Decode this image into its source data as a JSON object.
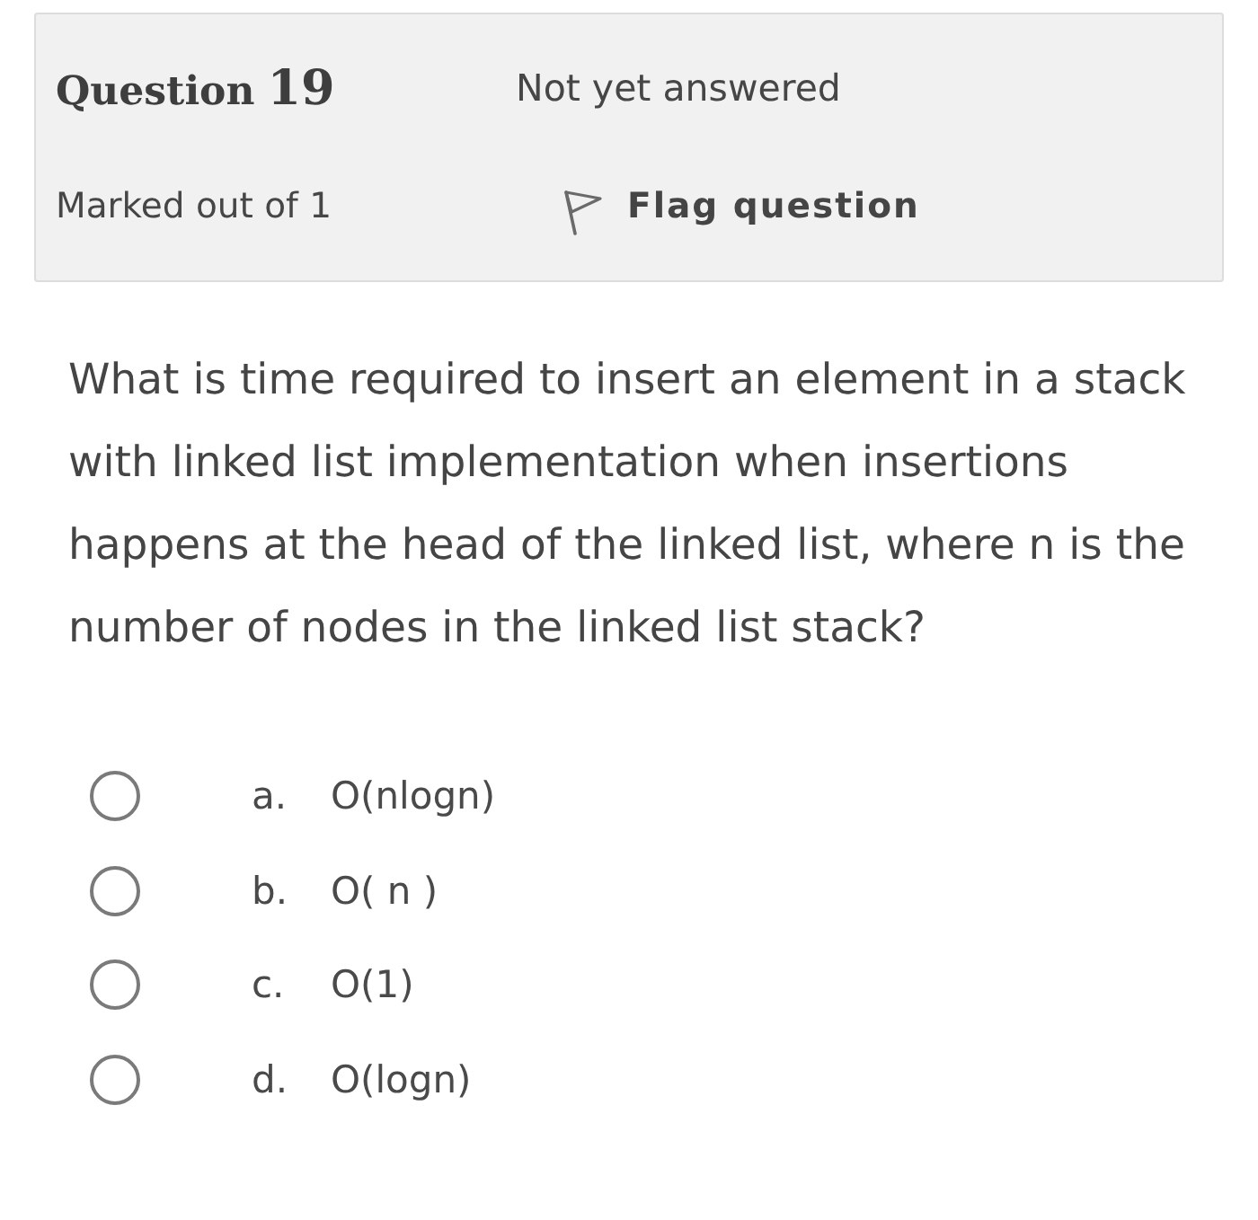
{
  "question_info": {
    "title": "Question",
    "number": "19",
    "status": "Not yet answered",
    "marks": "Marked out of 1",
    "flag": {
      "label": "Flag question",
      "flagged": false
    }
  },
  "question_text": "What is time required to insert an element in a stack with linked list implementation when insertions happens at the head of the linked list, where n is the number of nodes in the linked list stack?",
  "options": [
    {
      "letter": "a.",
      "text": "O(nlogn)",
      "selected": false
    },
    {
      "letter": "b.",
      "text": "O( n )",
      "selected": false
    },
    {
      "letter": "c.",
      "text": "O(1)",
      "selected": false
    },
    {
      "letter": "d.",
      "text": "O(logn)",
      "selected": false
    }
  ]
}
